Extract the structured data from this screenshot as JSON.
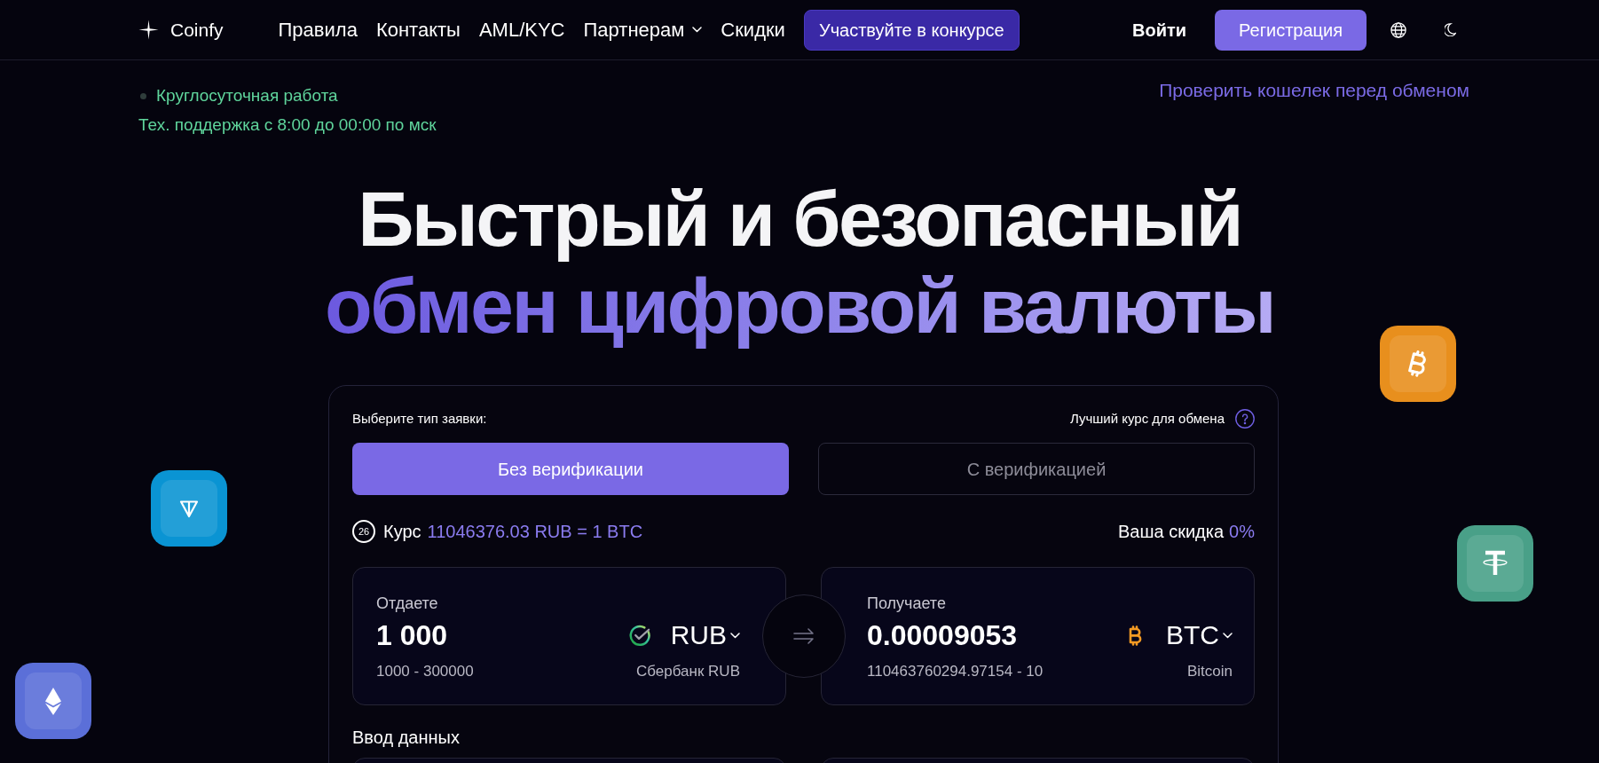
{
  "header": {
    "logo": "Coinfy",
    "nav": [
      {
        "label": "Правила",
        "dropdown": false
      },
      {
        "label": "Контакты",
        "dropdown": false
      },
      {
        "label": "AML/KYC",
        "dropdown": false
      },
      {
        "label": "Партнерам",
        "dropdown": true
      },
      {
        "label": "Скидки",
        "dropdown": false
      }
    ],
    "contest_button": "Участвуйте в конкурсе",
    "login": "Войти",
    "register": "Регистрация"
  },
  "status": {
    "availability": "Круглосуточная работа",
    "support_hours": "Тех. поддержка с 8:00 до 00:00 по мск",
    "wallet_check_link": "Проверить кошелек перед обменом"
  },
  "hero": {
    "line_1": "Быстрый и безопасный",
    "line_2": "обмен цифровой валюты"
  },
  "exchange": {
    "prompt": "Выберите тип заявки:",
    "best_rate": "Лучший курс для обмена",
    "tabs": [
      {
        "label": "Без верификации",
        "selected": true
      },
      {
        "label": "С верификацией",
        "selected": false
      }
    ],
    "timer": "26",
    "rate_label": "Курс",
    "rate_value": "11046376.03 RUB = 1 BTC",
    "discount_label": "Ваша скидка",
    "discount_value": "0%",
    "give": {
      "label": "Отдаете",
      "amount": "1 000",
      "range": "1000 - 300000",
      "currency": "RUB",
      "method": "Сбербанк RUB",
      "kind": "sber"
    },
    "receive": {
      "label": "Получаете",
      "amount": "0.00009053",
      "range": "110463760294.97154 - 10",
      "currency": "BTC",
      "method": "Bitcoin",
      "kind": "btc"
    },
    "data_title": "Ввод данных"
  },
  "floating_coins": [
    {
      "kind": "btc",
      "color": "#e88f1d"
    },
    {
      "kind": "ton",
      "color": "#0a94d3"
    },
    {
      "kind": "usdt",
      "color": "#49a088"
    },
    {
      "kind": "eth",
      "color": "#5b6fd8"
    }
  ]
}
